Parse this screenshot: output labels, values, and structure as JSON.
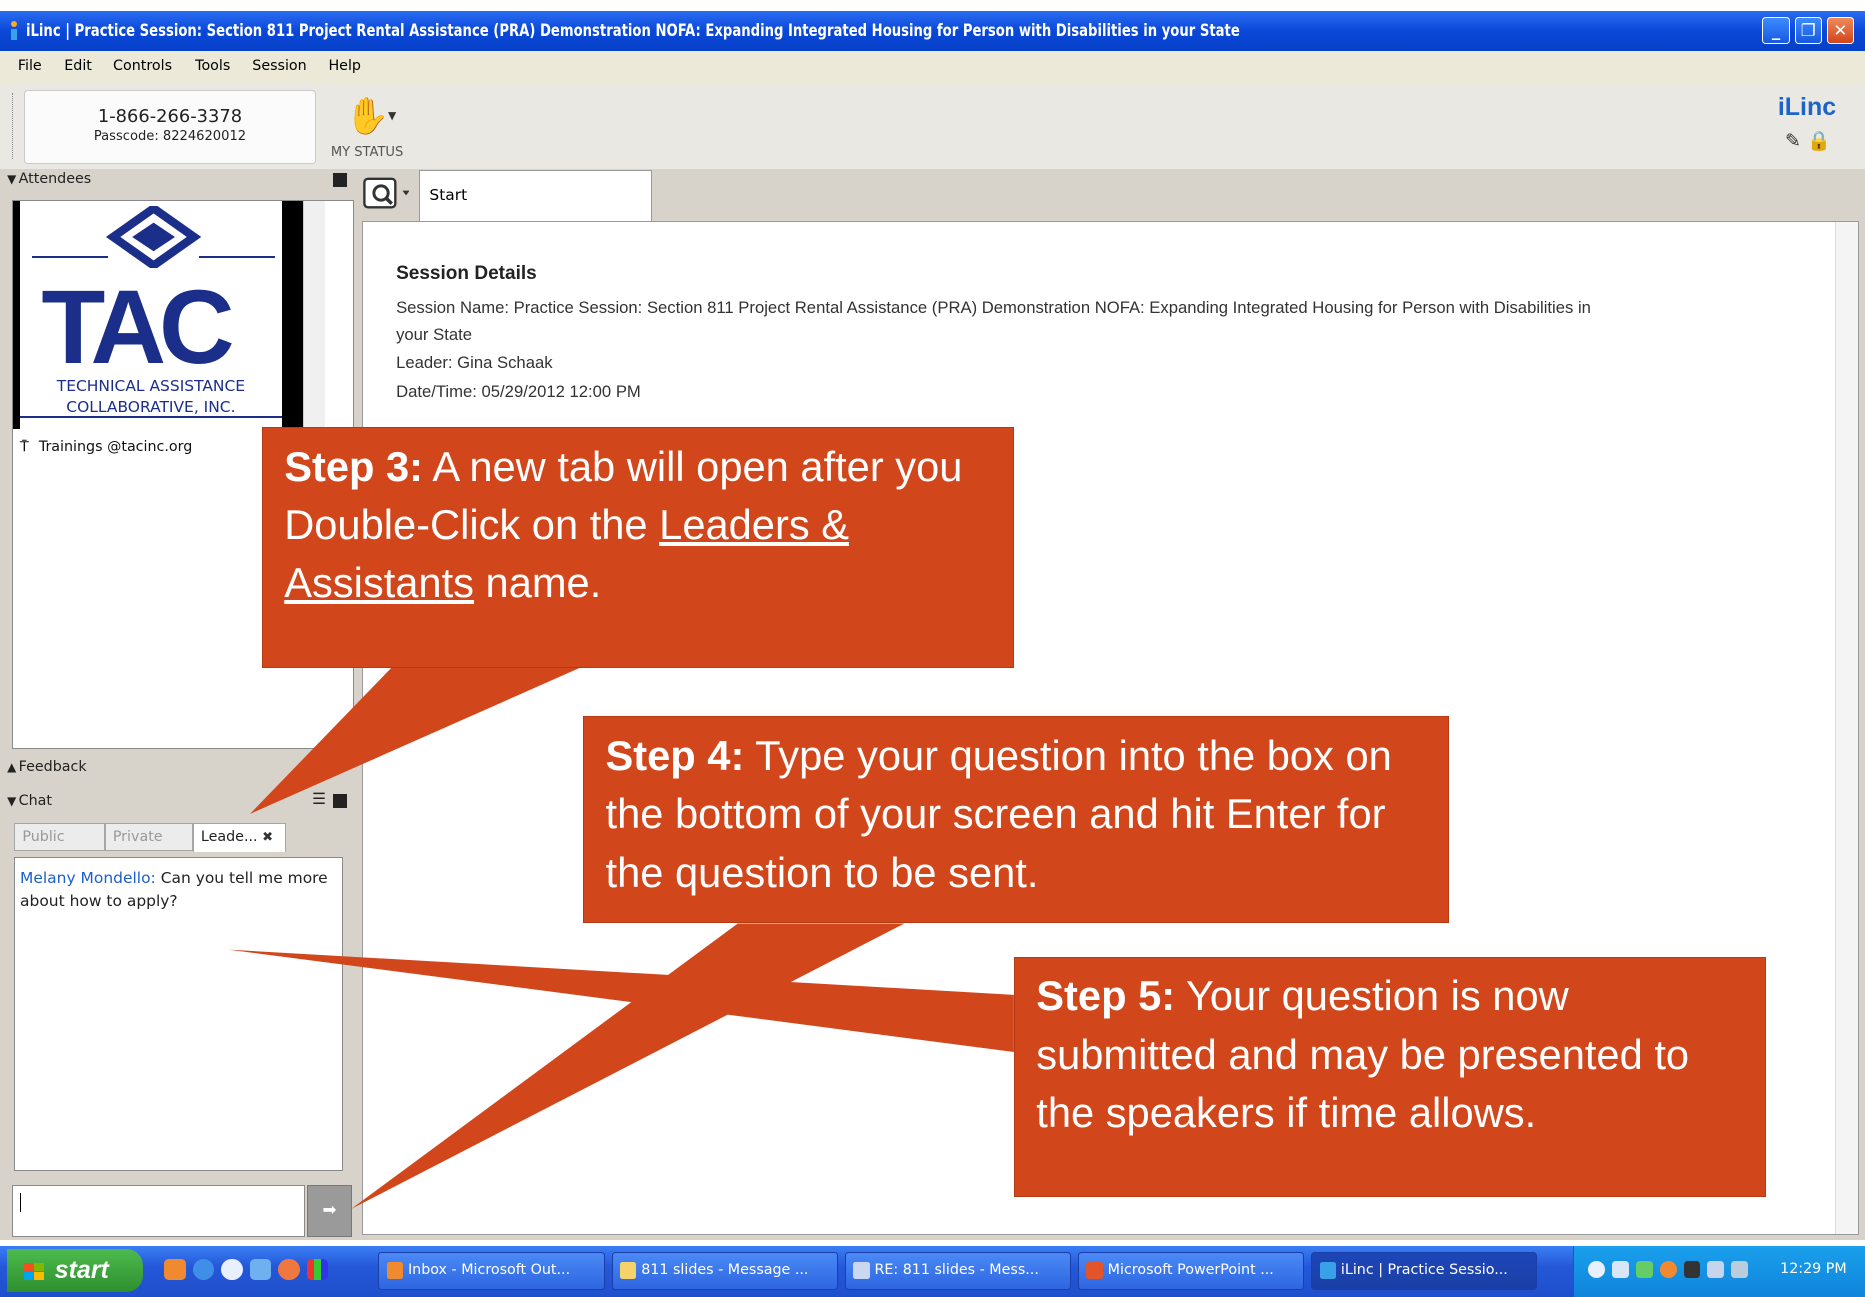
{
  "window": {
    "title": "iLinc | Practice Session: Section 811 Project Rental Assistance (PRA) Demonstration NOFA: Expanding Integrated Housing for Person with Disabilities in your State",
    "controls": [
      "minimize",
      "restore",
      "close"
    ]
  },
  "menu": [
    "File",
    "Edit",
    "Controls",
    "Tools",
    "Session",
    "Help"
  ],
  "toolbar": {
    "phone": "1-866-266-3378",
    "passcode": "Passcode: 8224620012",
    "status_label": "MY STATUS",
    "brand": "iLinc"
  },
  "attendees": {
    "header": "Attendees",
    "logo": {
      "letters": "TAC",
      "line1": "TECHNICAL ASSISTANCE",
      "line2": "COLLABORATIVE, INC."
    },
    "list": [
      {
        "name": "Trainings @tacinc.org"
      }
    ]
  },
  "feedback": {
    "header": "Feedback"
  },
  "chat": {
    "header": "Chat",
    "tabs": [
      "Public",
      "Private",
      "Leade..."
    ],
    "active_tab": 2,
    "messages": [
      {
        "sender": "Melany Mondello:",
        "text": "Can you tell me more about how to apply?"
      }
    ],
    "input_value": ""
  },
  "main": {
    "tab_label": "Start",
    "session_details": {
      "title": "Session Details",
      "name_line": "Session Name: Practice Session: Section 811 Project Rental Assistance (PRA) Demonstration NOFA: Expanding Integrated Housing for Person with Disabilities in",
      "name_line2": "your State",
      "leader": "Leader: Gina Schaak",
      "datetime": "Date/Time: 05/29/2012 12:00 PM"
    }
  },
  "callouts": {
    "step3": {
      "label": "Step 3:",
      "text_a": " A new tab will open after you Double-Click on the ",
      "link": "Leaders & Assistants",
      "text_b": "  name."
    },
    "step4": {
      "label": "Step 4:",
      "text": " Type your question into the box on the bottom of your screen and hit Enter for the question to be sent."
    },
    "step5": {
      "label": "Step 5:",
      "text": " Your question is now submitted and may be presented to the speakers if time allows."
    },
    "color": "#d2461c"
  },
  "taskbar": {
    "start": "start",
    "buttons": [
      "Inbox - Microsoft Out...",
      "811 slides - Message ...",
      "RE: 811 slides - Mess...",
      "Microsoft PowerPoint ...",
      "iLinc | Practice Sessio..."
    ],
    "active_button": 4,
    "clock": "12:29 PM"
  }
}
